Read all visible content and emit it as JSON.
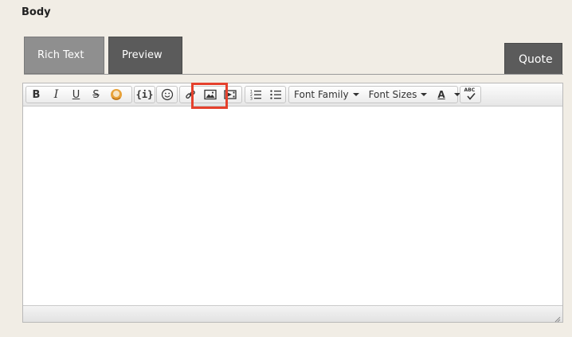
{
  "heading": "Body",
  "tabs": {
    "rich_text": "Rich Text",
    "preview": "Preview",
    "quote": "Quote"
  },
  "toolbar": {
    "groups": [
      {
        "buttons": [
          "bold-icon",
          "italic-icon",
          "underline-icon",
          "strikethrough-icon",
          "highlight-icon"
        ]
      },
      {
        "buttons": [
          "code-icon"
        ]
      },
      {
        "buttons": [
          "emoticon-icon"
        ]
      },
      {
        "buttons": [
          "link-icon",
          "image-icon",
          "media-icon"
        ]
      },
      {
        "buttons": [
          "numbered-list-icon",
          "bulleted-list-icon"
        ]
      }
    ],
    "bold_label": "B",
    "italic_label": "I",
    "underline_label": "U",
    "strike_label": "S",
    "code_label": "{i}",
    "font_family": "Font Family",
    "font_sizes": "Font Sizes",
    "text_color_label": "A",
    "spellcheck_label": "ABC",
    "highlight_color": "#e5412d"
  },
  "editor": {
    "content": ""
  }
}
